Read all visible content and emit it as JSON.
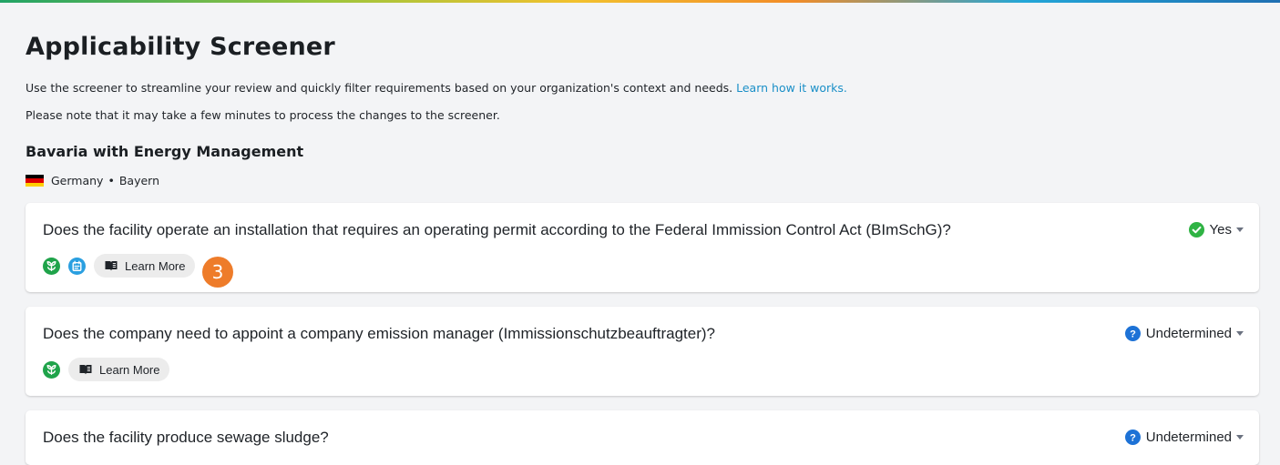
{
  "page": {
    "title": "Applicability Screener",
    "intro_text": "Use the screener to streamline your review and quickly filter requirements based on your organization's context and needs. ",
    "intro_link": "Learn how it works.",
    "note": "Please note that it may take a few minutes to process the changes to the screener."
  },
  "site": {
    "name": "Bavaria with Energy Management",
    "country": "Germany",
    "separator": "•",
    "region": "Bayern",
    "flag_colors": [
      "#000000",
      "#dd0000",
      "#ffce00"
    ]
  },
  "questions": [
    {
      "text": "Does the facility operate an installation that requires an operating permit according to the Federal Immission Control Act (BImSchG)?",
      "answer": "Yes",
      "answer_icon": "check-circle-icon",
      "answer_color": "#2fb344",
      "tags": [
        "environment-tag-icon",
        "energy-tag-icon"
      ],
      "learn_more": "Learn More"
    },
    {
      "text": "Does the company need to appoint a company emission manager (Immissionschutzbeauftragter)?",
      "answer": "Undetermined",
      "answer_icon": "question-circle-icon",
      "answer_color": "#1d72d6",
      "tags": [
        "environment-tag-icon"
      ],
      "learn_more": "Learn More"
    },
    {
      "text": "Does the facility produce sewage sludge?",
      "answer": "Undetermined",
      "answer_icon": "question-circle-icon",
      "answer_color": "#1d72d6"
    }
  ],
  "annotation": {
    "step_number": "3",
    "color": "#ee7c2a"
  },
  "colors": {
    "environment_tag": "#1fa34a",
    "energy_tag": "#2a9fe0",
    "link": "#1a8fc7"
  }
}
